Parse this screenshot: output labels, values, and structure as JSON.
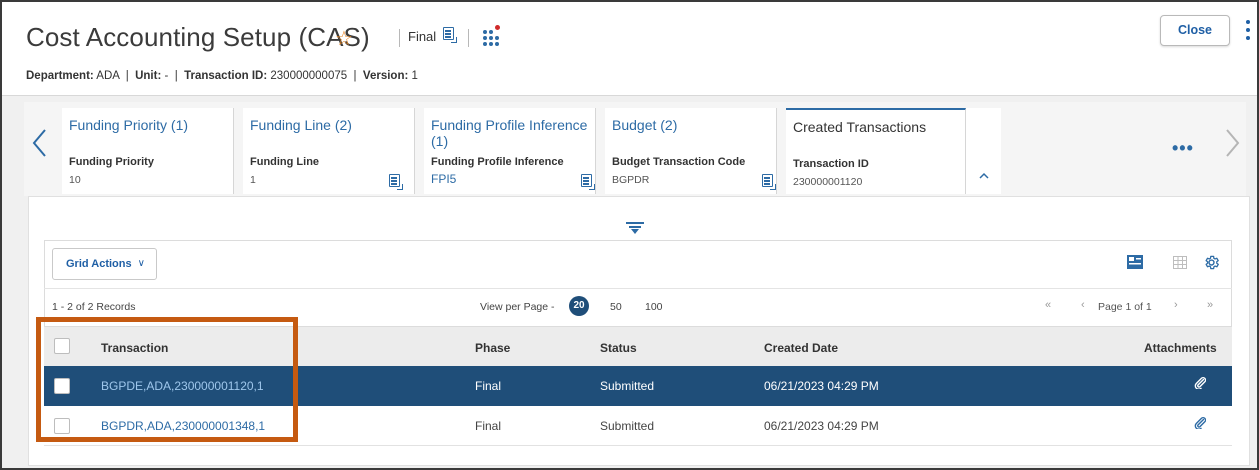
{
  "header": {
    "title": "Cost Accounting Setup (CAS)",
    "phase": "Final",
    "subtitle": {
      "department_label": "Department:",
      "department_value": "ADA",
      "unit_label": "Unit:",
      "unit_value": "-",
      "transaction_label": "Transaction ID:",
      "transaction_value": "230000000075",
      "version_label": "Version:",
      "version_value": "1"
    },
    "close_label": "Close"
  },
  "tabs": [
    {
      "title": "Funding Priority (1)",
      "field_label": "Funding Priority",
      "field_value": "10"
    },
    {
      "title": "Funding Line (2)",
      "field_label": "Funding Line",
      "field_value": "1"
    },
    {
      "title": "Funding Profile Inference (1)",
      "field_label": "Funding Profile Inference",
      "field_value": "FPI5"
    },
    {
      "title": "Budget (2)",
      "field_label": "Budget Transaction Code",
      "field_value": "BGPDR"
    },
    {
      "title": "Created Transactions",
      "field_label": "Transaction ID",
      "field_value": "230000001120"
    }
  ],
  "grid": {
    "actions_label": "Grid Actions",
    "records_text": "1 - 2 of 2 Records",
    "view_per_page_label": "View per Page -",
    "page_sizes": [
      "20",
      "50",
      "100"
    ],
    "page_text": "Page 1 of 1",
    "columns": {
      "transaction": "Transaction",
      "phase": "Phase",
      "status": "Status",
      "created_date": "Created Date",
      "attachments": "Attachments"
    },
    "rows": [
      {
        "transaction": "BGPDE,ADA,230000001120,1",
        "phase": "Final",
        "status": "Submitted",
        "created_date": "06/21/2023 04:29 PM"
      },
      {
        "transaction": "BGPDR,ADA,230000001348,1",
        "phase": "Final",
        "status": "Submitted",
        "created_date": "06/21/2023 04:29 PM"
      }
    ]
  },
  "colors": {
    "accent": "#2d6ba5",
    "selected_row": "#1f4e79",
    "highlight": "#c55a11",
    "star": "#e8821e"
  },
  "icons": [
    "star-icon",
    "document-icon",
    "apps-grid-icon",
    "kebab-menu-icon",
    "chevron-left-icon",
    "chevron-right-icon",
    "chevron-up-icon",
    "ellipsis-icon",
    "expand-lines-icon",
    "chevron-down-icon",
    "first-page-icon",
    "prev-page-icon",
    "next-page-icon",
    "last-page-icon",
    "card-view-icon",
    "grid-view-icon",
    "settings-gear-icon",
    "paperclip-icon"
  ]
}
